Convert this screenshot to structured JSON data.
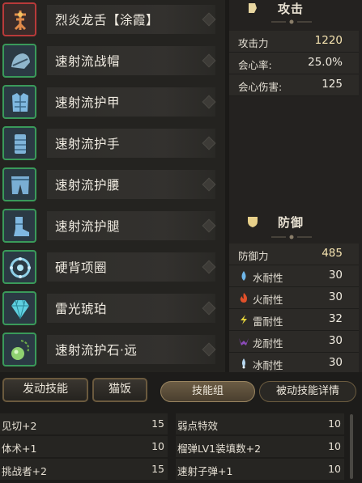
{
  "equipment": [
    {
      "name": "烈炎龙舌【涂霞】",
      "icon": "weapon-icon",
      "frame": "#b83a3a"
    },
    {
      "name": "速射流战帽",
      "icon": "helmet-icon",
      "frame": "#3a9a5a"
    },
    {
      "name": "速射流护甲",
      "icon": "chest-armor-icon",
      "frame": "#3a9a5a"
    },
    {
      "name": "速射流护手",
      "icon": "gauntlet-icon",
      "frame": "#3a9a5a"
    },
    {
      "name": "速射流护腰",
      "icon": "waist-armor-icon",
      "frame": "#3a9a5a"
    },
    {
      "name": "速射流护腿",
      "icon": "leg-armor-icon",
      "frame": "#3a9a5a"
    },
    {
      "name": "硬背项圈",
      "icon": "collar-icon",
      "frame": "#3a9a5a"
    },
    {
      "name": "雷光琥珀",
      "icon": "gem-icon",
      "frame": "#3a9a5a"
    },
    {
      "name": "速射流护石·远",
      "icon": "charm-icon",
      "frame": "#3a9a5a"
    }
  ],
  "attack": {
    "title": "攻击",
    "rows": [
      {
        "label": "攻击力",
        "value": "1220"
      },
      {
        "label": "会心率:",
        "value": "25.0%"
      },
      {
        "label": "会心伤害:",
        "value": "125"
      }
    ]
  },
  "defense": {
    "title": "防御",
    "defense_label": "防御力",
    "defense_value": "485",
    "resistances": [
      {
        "label": "水耐性",
        "value": "30",
        "icon": "water-icon",
        "color": "#6fb6e8"
      },
      {
        "label": "火耐性",
        "value": "30",
        "icon": "fire-icon",
        "color": "#e0502a"
      },
      {
        "label": "雷耐性",
        "value": "32",
        "icon": "thunder-icon",
        "color": "#e3d23a"
      },
      {
        "label": "龙耐性",
        "value": "30",
        "icon": "dragon-icon",
        "color": "#8a4ab8"
      },
      {
        "label": "冰耐性",
        "value": "30",
        "icon": "ice-icon",
        "color": "#b8d8f0"
      }
    ]
  },
  "tabs": {
    "active_skills": "发动技能",
    "food": "猫饭",
    "skill_group": "技能组",
    "passive_details": "被动技能详情"
  },
  "skills": {
    "left": [
      {
        "name": "见切+2",
        "level": "15"
      },
      {
        "name": "体术+1",
        "level": "10"
      },
      {
        "name": "挑战者+2",
        "level": "15"
      }
    ],
    "right": [
      {
        "name": "弱点特效",
        "level": "10"
      },
      {
        "name": "榴弹LV1装填数+2",
        "level": "10"
      },
      {
        "name": "速射子弹+1",
        "level": "10"
      }
    ]
  }
}
